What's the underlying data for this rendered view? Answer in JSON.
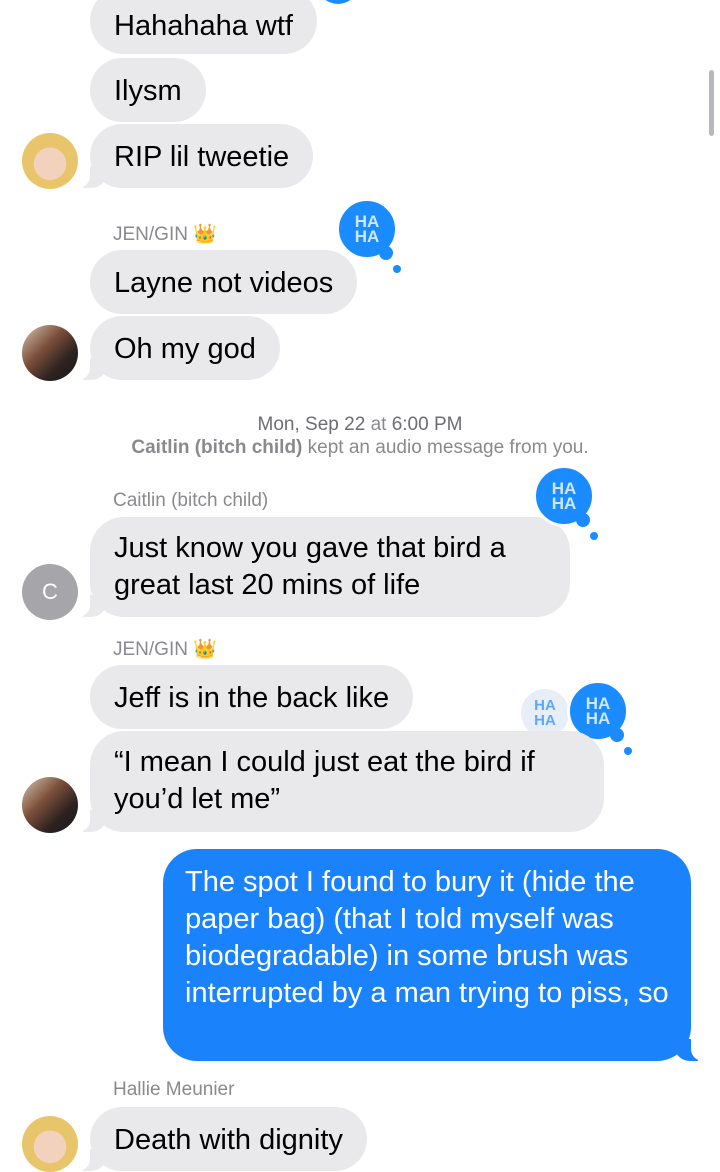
{
  "messages": [
    {
      "text": "Hahahaha wtf"
    },
    {
      "text": "Ilysm"
    },
    {
      "text": "RIP lil tweetie"
    },
    {
      "sender": "JEN/GIN",
      "sender_emoji": "👑",
      "text": "Layne not videos"
    },
    {
      "text": "Oh my god"
    },
    {
      "sender": "Caitlin (bitch child)",
      "text": "Just know you gave that bird a great last 20 mins of life"
    },
    {
      "sender": "JEN/GIN",
      "sender_emoji": "👑",
      "text": "Jeff is in the back like"
    },
    {
      "text": "“I mean I could just eat the bird if you’d let me”"
    },
    {
      "text": "The spot I found to bury it (hide the paper bag) (that I told myself was biodegradable) in some brush was interrupted by a man trying to piss, so"
    },
    {
      "sender": "Hallie Meunier",
      "text": "Death with dignity"
    }
  ],
  "timestamp": {
    "day": "Mon, Sep 22",
    "at": "at",
    "time": "6:00 PM"
  },
  "kept_notice": {
    "name": "Caitlin (bitch child)",
    "rest": "kept an audio message from you."
  },
  "avatar_letter": "C",
  "reaction": {
    "line1": "HA",
    "line2": "HA"
  },
  "colors": {
    "sent": "#1a82fb",
    "received": "#e9e9eb",
    "reaction": "#1b8cff"
  }
}
